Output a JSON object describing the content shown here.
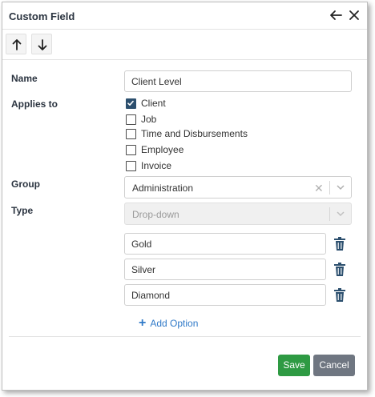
{
  "dialog": {
    "title": "Custom Field"
  },
  "form": {
    "name_label": "Name",
    "name_value": "Client Level",
    "applies_label": "Applies to",
    "applies_options": [
      {
        "label": "Client",
        "checked": true
      },
      {
        "label": "Job",
        "checked": false
      },
      {
        "label": "Time and Disbursements",
        "checked": false
      },
      {
        "label": "Employee",
        "checked": false
      },
      {
        "label": "Invoice",
        "checked": false
      }
    ],
    "group_label": "Group",
    "group_value": "Administration",
    "type_label": "Type",
    "type_value": "Drop-down",
    "options": [
      "Gold",
      "Silver",
      "Diamond"
    ],
    "add_option_label": "Add Option"
  },
  "footer": {
    "save_label": "Save",
    "cancel_label": "Cancel"
  },
  "colors": {
    "save": "#2e9a43",
    "cancel": "#6f7681",
    "link": "#2f79c8",
    "checkbox_checked": "#2c4f6e"
  }
}
